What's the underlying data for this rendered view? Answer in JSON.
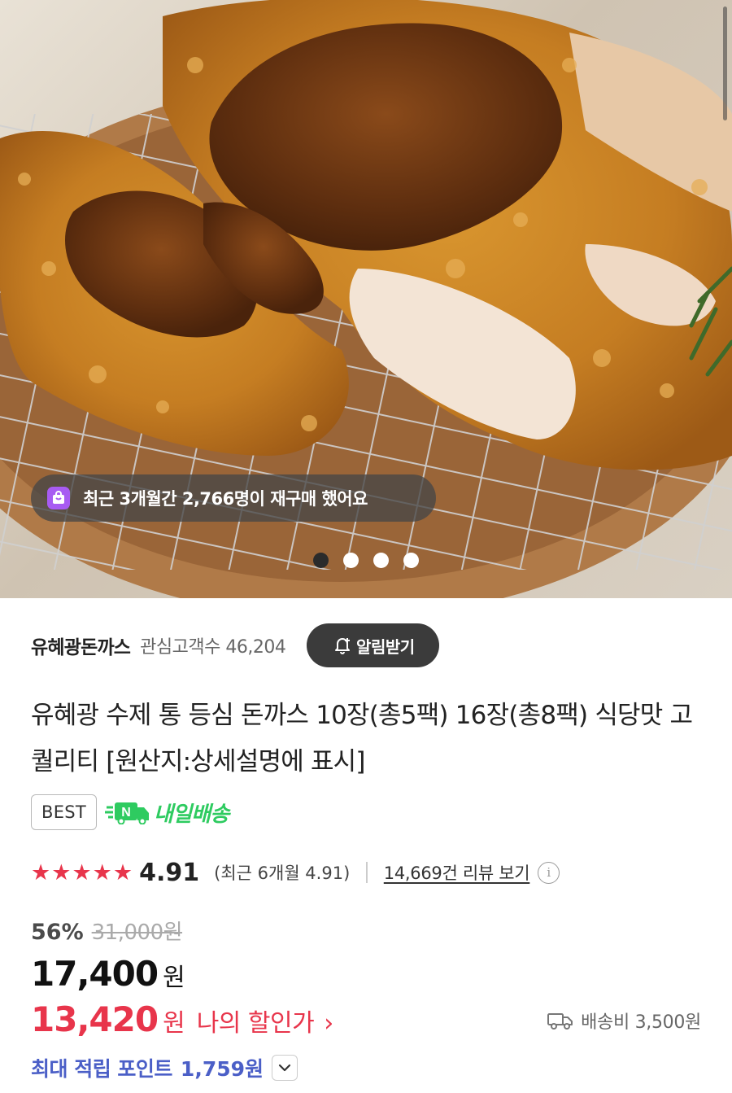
{
  "hero": {
    "repurchase_text": "최근 3개월간 2,766명이 재구매 했어요",
    "bag_icon": "shopping-bag-icon",
    "slide_count": 4,
    "active_slide": 1
  },
  "store": {
    "name": "유혜광돈까스",
    "followers": "관심고객수 46,204",
    "notify_label": "알림받기",
    "notify_icon": "bell-plus-icon"
  },
  "product": {
    "title": "유혜광 수제 통 등심 돈까스 10장(총5팩) 16장(총8팩) 식당맛 고퀄리티 [원산지:상세설명에 표시]"
  },
  "badges": {
    "best": "BEST",
    "delivery_label": "내일배송",
    "delivery_icon": "naver-truck-icon"
  },
  "rating": {
    "stars": 5,
    "value": "4.91",
    "recent": "(최근 6개월 4.91)",
    "review_link": "14,669건 리뷰 보기",
    "info_icon": "info-icon"
  },
  "price": {
    "discount_rate": "56%",
    "original": "31,000원",
    "current": "17,400",
    "currency": "원",
    "my_discount_price": "13,420",
    "my_discount_currency": "원",
    "my_discount_label": "나의 할인가",
    "my_discount_chevron": "›"
  },
  "shipping": {
    "label": "배송비 3,500원",
    "icon": "truck-icon"
  },
  "points": {
    "label": "최대 적립 포인트",
    "value": "1,759원",
    "toggle_icon": "chevron-down-icon"
  },
  "colors": {
    "accent_red": "#e8354b",
    "points_blue": "#4b5fc7",
    "delivery_green": "#2ecb60",
    "bag_purple": "#a85bf2"
  }
}
